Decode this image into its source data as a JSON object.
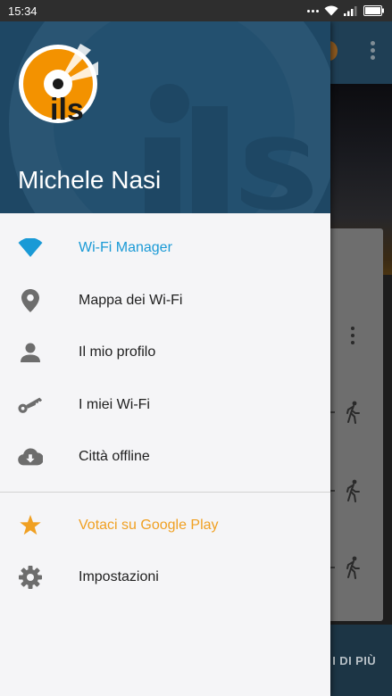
{
  "status_bar": {
    "time": "15:34",
    "icons": [
      "more-dots-icon",
      "wifi-icon",
      "signal-icon",
      "battery-icon"
    ]
  },
  "background_app": {
    "bottom_action_label": "I DI PIÙ",
    "toolbar_color": "#1f3f55"
  },
  "drawer": {
    "header": {
      "user_name": "Michele Nasi",
      "logo_text": "ils",
      "background_color": "#1e4764"
    },
    "menu_primary": [
      {
        "label": "Wi-Fi Manager",
        "icon": "wifi-icon",
        "state": "active"
      },
      {
        "label": "Mappa dei Wi-Fi",
        "icon": "location-pin-icon",
        "state": "normal"
      },
      {
        "label": "Il mio profilo",
        "icon": "person-icon",
        "state": "normal"
      },
      {
        "label": "I miei Wi-Fi",
        "icon": "key-icon",
        "state": "normal"
      },
      {
        "label": "Città offline",
        "icon": "cloud-download-icon",
        "state": "normal"
      }
    ],
    "menu_secondary": [
      {
        "label": "Votaci su Google Play",
        "icon": "star-icon",
        "state": "accent"
      },
      {
        "label": "Impostazioni",
        "icon": "gear-icon",
        "state": "normal"
      }
    ]
  },
  "colors": {
    "active": "#1a9ad6",
    "accent": "#f0a022",
    "icon_gray": "#6d6d6d",
    "logo_orange": "#f39200"
  }
}
